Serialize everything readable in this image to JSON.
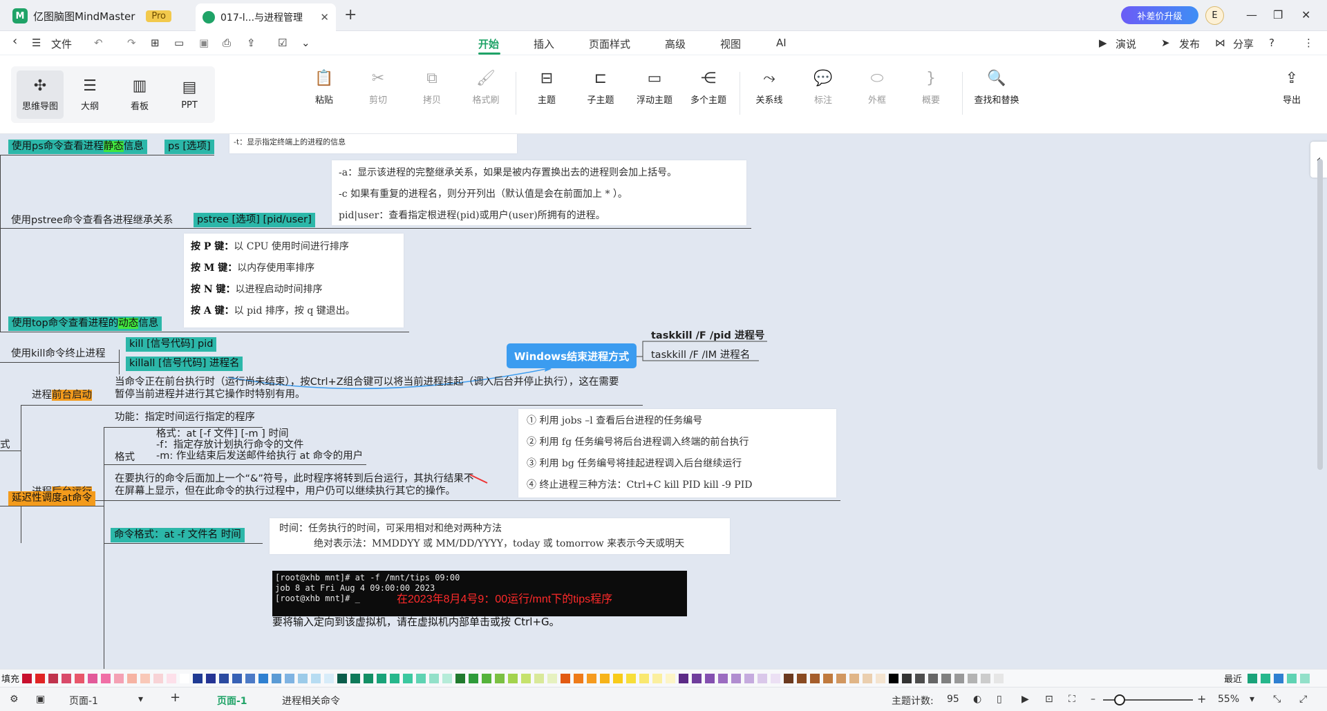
{
  "titlebar": {
    "app_name": "亿图脑图MindMaster",
    "pro_badge": "Pro",
    "doc_tab": "017-l...与进程管理",
    "close": "✕",
    "new_tab": "+",
    "upgrade": "补差价升级",
    "avatar": "E"
  },
  "menu": {
    "file": "文件",
    "tabs": [
      "开始",
      "插入",
      "页面样式",
      "高级",
      "视图",
      "AI"
    ],
    "right": [
      "演说",
      "发布",
      "分享"
    ]
  },
  "views": [
    "思维导图",
    "大纲",
    "看板",
    "PPT"
  ],
  "ribbon": [
    "粘贴",
    "剪切",
    "拷贝",
    "格式刷",
    "主题",
    "子主题",
    "浮动主题",
    "多个主题",
    "关系线",
    "标注",
    "外框",
    "概要",
    "查找和替换"
  ],
  "export": "导出",
  "map": {
    "ps_label": "使用ps命令查看进程",
    "ps_hl": "静态",
    "ps_suffix": "信息",
    "ps_tag": "ps [选项]",
    "ps_note": "-t：显示指定终端上的进程的信息",
    "pstree_label": "使用pstree命令查看各进程继承关系",
    "pstree_tag": "pstree [选项] [pid/user]",
    "pstree_notes": [
      "-a：显示该进程的完整继承关系，如果是被内存置换出去的进程则会加上括号。",
      "-c 如果有重复的进程名，则分开列出（默认值是会在前面加上 * ）。",
      "pid|user：查看指定根进程(pid)或用户(user)所拥有的进程。"
    ],
    "top_label": "使用top命令查看进程的",
    "top_hl": "动态",
    "top_suffix": "信息",
    "top_keys": [
      {
        "k": "按 P 键：",
        "v": "以 CPU 使用时间进行排序"
      },
      {
        "k": "按 M 键：",
        "v": "以内存使用率排序"
      },
      {
        "k": "按 N 键：",
        "v": "以进程启动时间排序"
      },
      {
        "k": "按 A 键：",
        "v": "以 pid 排序，按 q 键退出。"
      }
    ],
    "kill_label": "使用kill命令终止进程",
    "kill_tag1": "kill [信号代码] pid",
    "kill_tag2": "killall [信号代码] 进程名",
    "win_node": "Windows结束进程方式",
    "win_cmd1": "taskkill  /F /pid 进程号",
    "win_cmd2": "taskkill /F /IM 进程名",
    "fg_prefix": "进程",
    "fg_hl": "前台启动",
    "fg_desc1": "当命令正在前台执行时（运行尚未结束），按Ctrl+Z组合键可以将当前进程挂起（调入后台并停止执行），这在需要",
    "fg_desc2": "暂停当前进程并进行其它操作时特别有用。",
    "left_stub": "式",
    "bg_prefix": "进程",
    "bg_hl": "后台运行",
    "bg_desc1": "在要执行的命令后面加上一个“&”符号，此时程序将转到后台运行，其执行结果不",
    "bg_desc2": "在屏幕上显示，但在此命令的执行过程中，用户仍可以继续执行其它的操作。",
    "jobs_notes": [
      "① 利用 jobs –l 查看后台进程的任务编号",
      "② 利用 fg 任务编号将后台进程调入终端的前台执行",
      "③ 利用 bg 任务编号将挂起进程调入后台继续运行",
      "④ 终止进程三种方法：Ctrl+C  kill PID   kill -9 PID"
    ],
    "at_label": "延迟性调度at命令",
    "at_func": "功能：指定时间运行指定的程序",
    "at_fmt_label": "格式",
    "at_fmt_lines": [
      "格式：at [-f 文件] [-m ] 时间",
      "-f：指定存放计划执行命令的文件",
      "-m: 作业结束后发送邮件给执行 at 命令的用户"
    ],
    "term_lines": [
      "[root@xhb mnt]# at -f /mnt/tips 09:00",
      "job 8 at Fri Aug  4 09:00:00 2023",
      "[root@xhb mnt]# _"
    ],
    "term_note": "在2023年8月4号9：00运行/mnt下的tips程序",
    "vm_hint": "要将输入定向到该虚拟机，请在虚拟机内部单击或按 Ctrl+G。",
    "cmd_fmt": "命令格式：at -f 文件名  时间",
    "time_lines": [
      "时间：任务执行的时间，可采用相对和绝对两种方法",
      "绝对表示法：MMDDYY 或 MM/DD/YYYY，today 或 tomorrow 来表示今天或明天"
    ]
  },
  "palette": {
    "fill_label": "填充",
    "recent_label": "最近",
    "colors": [
      "#c8102e",
      "#e02424",
      "#c0334d",
      "#d94a6a",
      "#e8576b",
      "#e25a9a",
      "#f06fa6",
      "#f4a1b4",
      "#f6b3a3",
      "#f9c8b8",
      "#f8d3d6",
      "#fde0ea",
      "#ffffff",
      "#1f3a93",
      "#253494",
      "#2b4aa0",
      "#3761b5",
      "#4c7ac6",
      "#2f80d1",
      "#5b9bd5",
      "#7fb3e2",
      "#9ccbe9",
      "#b7dcf2",
      "#d7ecf9",
      "#0b5d4b",
      "#0f7a5a",
      "#138f65",
      "#1aa37a",
      "#26b78c",
      "#3cc8a0",
      "#5fd3b3",
      "#93e0c9",
      "#b6ecd9",
      "#217a2e",
      "#2e9b3a",
      "#55b33b",
      "#7bc043",
      "#a3d34d",
      "#c6e26d",
      "#d9e99a",
      "#e6f1c0",
      "#e25a12",
      "#ee7b1a",
      "#f59b1f",
      "#f6b319",
      "#f8cb1a",
      "#f7de3a",
      "#f9e870",
      "#fbef9f",
      "#fdf5c7",
      "#5b2a86",
      "#6f3d9c",
      "#8450b0",
      "#9b6cc1",
      "#b08dd0",
      "#c5abde",
      "#dac8ea",
      "#ece0f4",
      "#6b3a1f",
      "#8a4b22",
      "#a55e2c",
      "#c07a3e",
      "#d19760",
      "#e0b587",
      "#ebcfaf",
      "#f4e4d0",
      "#000000",
      "#333333",
      "#4d4d4d",
      "#666666",
      "#808080",
      "#999999",
      "#b3b3b3",
      "#cccccc",
      "#e6e6e6"
    ],
    "recent": [
      "#1aa37a",
      "#26b78c",
      "#2f80d1",
      "#5fd3b3",
      "#93e0c9"
    ]
  },
  "status": {
    "page_select": "页面-1",
    "add": "+",
    "page_tab": "页面-1",
    "page_name": "进程相关命令",
    "topic_count_label": "主题计数:",
    "topic_count": "95",
    "zoom_minus": "–",
    "zoom_plus": "+",
    "zoom": "55%"
  }
}
